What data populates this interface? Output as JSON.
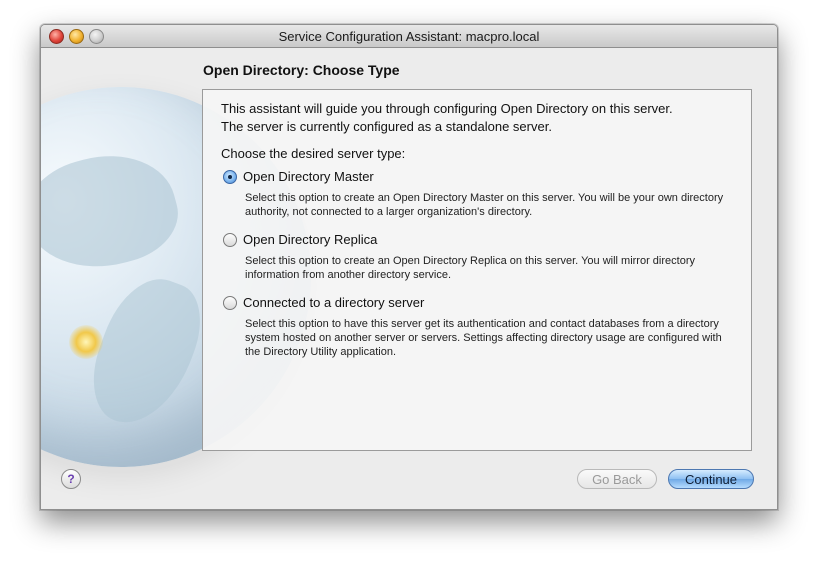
{
  "window": {
    "title": "Service Configuration Assistant: macpro.local"
  },
  "page": {
    "heading": "Open Directory: Choose Type",
    "intro_line1": "This assistant will guide you through configuring Open Directory on this server.",
    "intro_line2": "The server is currently configured as a standalone server.",
    "prompt": "Choose the desired server type:",
    "options": [
      {
        "label": "Open Directory Master",
        "selected": true,
        "description": "Select this option to create an Open Directory Master on this server.  You will be your own directory authority, not connected to a larger organization's directory."
      },
      {
        "label": "Open Directory Replica",
        "selected": false,
        "description": "Select this option to create an Open Directory Replica on this server.  You will mirror directory information from another directory service."
      },
      {
        "label": "Connected to a directory server",
        "selected": false,
        "description": "Select this option to have this server get its authentication and contact databases from a directory system hosted on another server or servers.  Settings affecting directory usage are configured with the Directory Utility application."
      }
    ]
  },
  "footer": {
    "help_glyph": "?",
    "back_label": "Go Back",
    "continue_label": "Continue"
  },
  "colors": {
    "accent": "#6fa9e6",
    "window_bg": "#ececec"
  }
}
